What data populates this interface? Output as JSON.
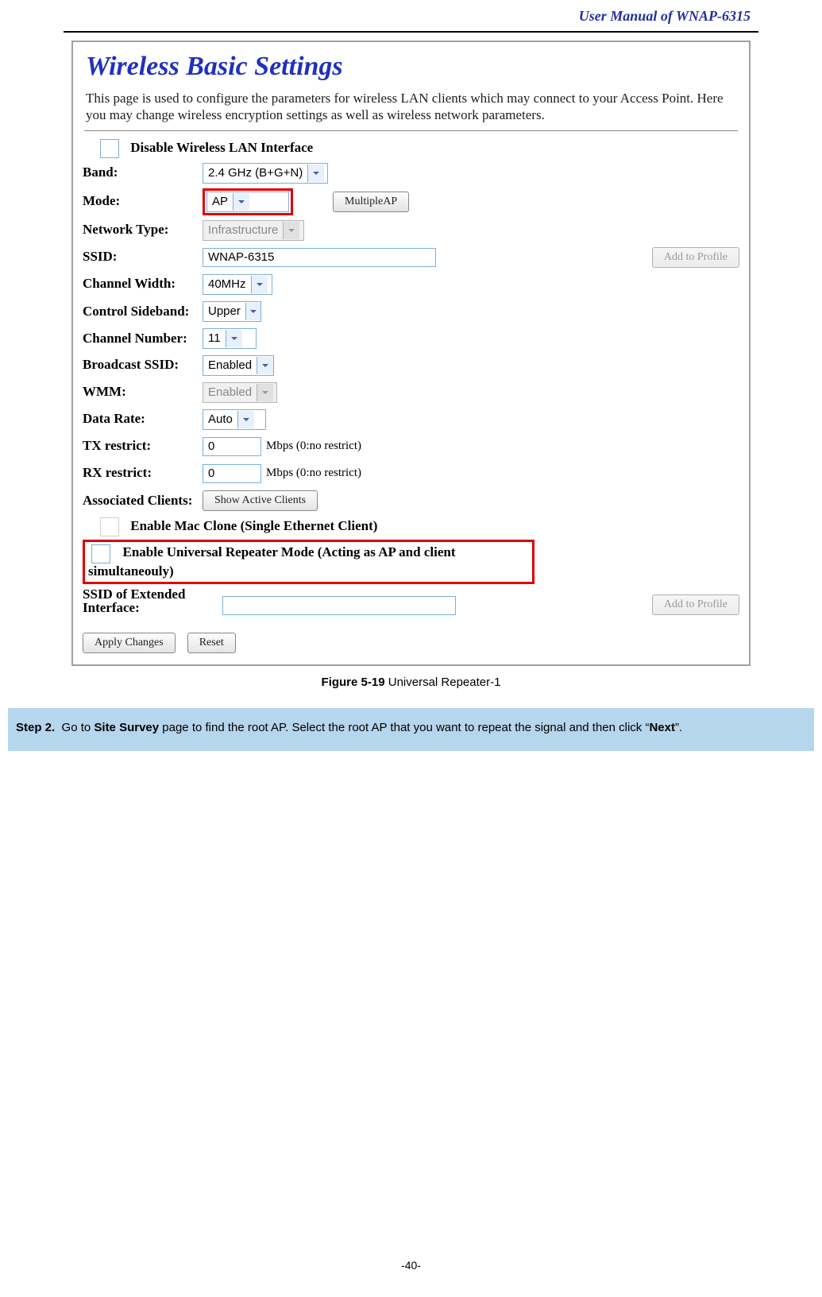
{
  "header": {
    "title": "User Manual of WNAP-6315"
  },
  "page_number": "-40-",
  "figure": {
    "title": "Wireless Basic Settings",
    "description": "This page is used to configure the parameters for wireless LAN clients which may connect to your Access Point. Here you may change wireless encryption settings as well as wireless network parameters.",
    "disable_label": "Disable Wireless LAN Interface",
    "rows": {
      "band": {
        "label": "Band:",
        "value": "2.4 GHz (B+G+N)"
      },
      "mode": {
        "label": "Mode:",
        "value": "AP",
        "button": "MultipleAP"
      },
      "network_type": {
        "label": "Network Type:",
        "value": "Infrastructure"
      },
      "ssid": {
        "label": "SSID:",
        "value": "WNAP-6315",
        "button": "Add to Profile"
      },
      "channel_width": {
        "label": "Channel Width:",
        "value": "40MHz"
      },
      "control_sideband": {
        "label": "Control Sideband:",
        "value": "Upper"
      },
      "channel_number": {
        "label": "Channel Number:",
        "value": "11"
      },
      "broadcast_ssid": {
        "label": "Broadcast SSID:",
        "value": "Enabled"
      },
      "wmm": {
        "label": "WMM:",
        "value": "Enabled"
      },
      "data_rate": {
        "label": "Data Rate:",
        "value": "Auto"
      },
      "tx": {
        "label": "TX restrict:",
        "value": "0",
        "hint": "Mbps (0:no restrict)"
      },
      "rx": {
        "label": "RX restrict:",
        "value": "0",
        "hint": "Mbps (0:no restrict)"
      },
      "assoc": {
        "label": "Associated Clients:",
        "button": "Show Active Clients"
      },
      "mac_clone": "Enable Mac Clone (Single Ethernet Client)",
      "repeater": "Enable Universal Repeater Mode (Acting as AP and client simultaneouly)",
      "ext": {
        "label": "SSID of Extended Interface:",
        "value": "",
        "button": "Add to Profile"
      }
    },
    "buttons": {
      "apply": "Apply Changes",
      "reset": "Reset"
    }
  },
  "caption": {
    "bold": "Figure 5-19",
    "rest": " Universal Repeater-1"
  },
  "step": {
    "label": "Step 2.",
    "text_a": "Go to ",
    "bold_a": "Site Survey",
    "text_b": " page to find the root AP. Select the root AP that you want to repeat the signal and then click “",
    "bold_b": "Next",
    "text_c": "”."
  }
}
